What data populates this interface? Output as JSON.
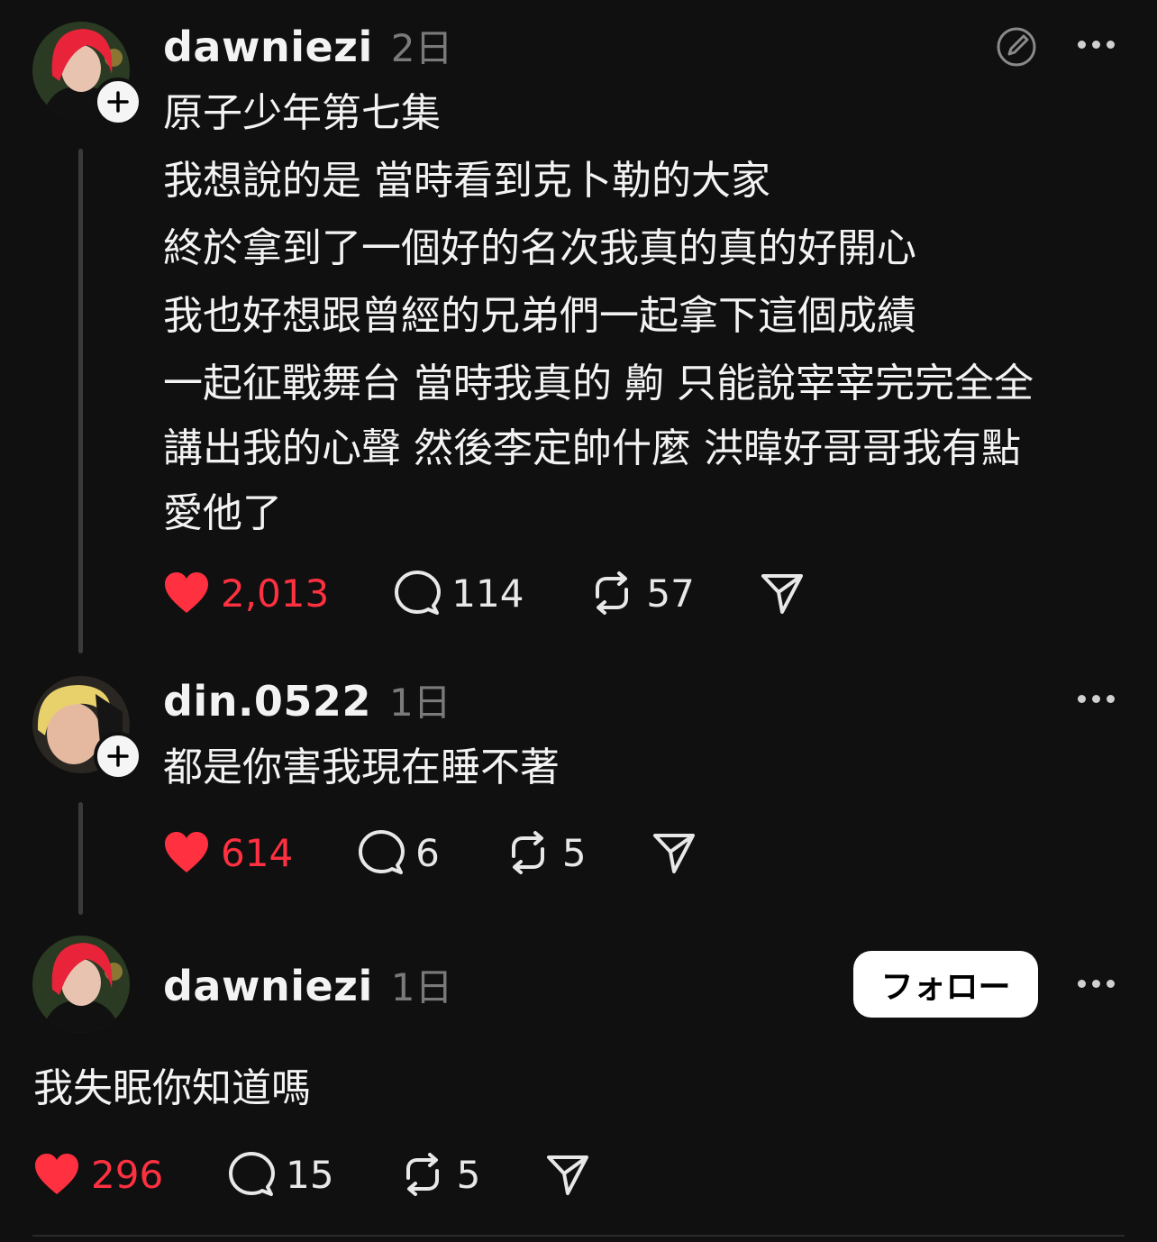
{
  "posts": [
    {
      "username": "dawniezi",
      "time": "2日",
      "lines": [
        "原子少年第七集",
        "我想說的是 當時看到克卜勒的大家",
        "終於拿到了一個好的名次我真的真的好開心",
        "我也好想跟曾經的兄弟們一起拿下這個成績",
        "一起征戰舞台 當時我真的 齁 只能說宰宰完完全全",
        "講出我的心聲 然後李定帥什麼 洪暐好哥哥我有點",
        "愛他了"
      ],
      "likes": "2,013",
      "comments": "114",
      "reposts": "57"
    },
    {
      "username": "din.0522",
      "time": "1日",
      "lines": [
        "都是你害我現在睡不著"
      ],
      "likes": "614",
      "comments": "6",
      "reposts": "5"
    },
    {
      "username": "dawniezi",
      "time": "1日",
      "follow_label": "フォロー",
      "lines": [
        "我失眠你知道嗎"
      ],
      "likes": "296",
      "comments": "15",
      "reposts": "5"
    }
  ],
  "colors": {
    "background": "#101010",
    "like": "#ff3040",
    "muted": "#7a7a7a"
  },
  "icons": [
    "heart-icon",
    "comment-icon",
    "repost-icon",
    "share-icon",
    "more-icon",
    "edit-icon",
    "plus-icon"
  ]
}
